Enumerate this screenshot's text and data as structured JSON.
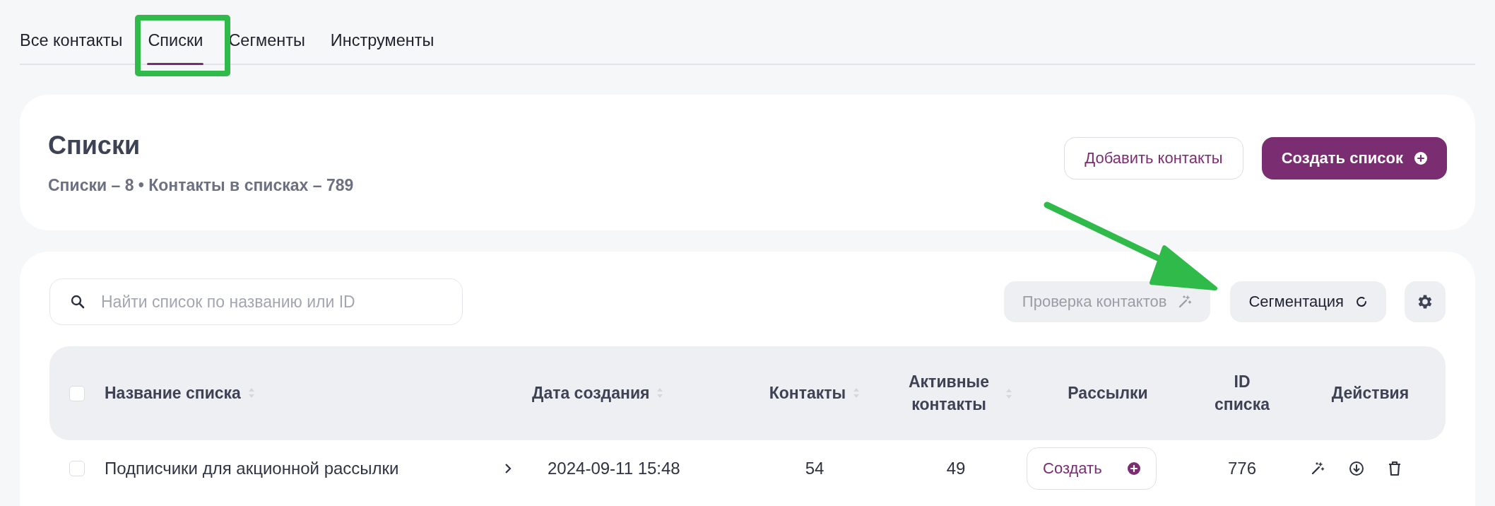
{
  "tabs": [
    {
      "label": "Все контакты",
      "selected": false
    },
    {
      "label": "Списки",
      "selected": true
    },
    {
      "label": "Сегменты",
      "selected": false
    },
    {
      "label": "Инструменты",
      "selected": false
    }
  ],
  "header": {
    "title": "Списки",
    "subtitle": "Списки – 8 • Контакты в списках – 789",
    "buttons": [
      {
        "label": "Добавить контакты",
        "kind": "outline"
      },
      {
        "label": "Создать список",
        "kind": "primary"
      }
    ]
  },
  "toolbar": {
    "search": {
      "placeholder": "Найти список по названию или ID"
    },
    "buttons": [
      {
        "label": "Проверка контактов",
        "kind": "wand",
        "disabled": true
      },
      {
        "label": "Сегментация",
        "kind": "refresh",
        "disabled": false
      }
    ]
  },
  "table": {
    "header_checked": false,
    "columns": [
      {
        "label": "Название списка",
        "sortable": true
      },
      {
        "label": "Дата создания",
        "sortable": true
      },
      {
        "label": "Контакты",
        "sortable": true
      },
      {
        "label": "Активные контакты",
        "sortable": true
      },
      {
        "label": "Рассылки",
        "sortable": false
      },
      {
        "label": "ID списка",
        "sortable": false
      },
      {
        "label": "Действия",
        "sortable": false
      }
    ],
    "rows": [
      {
        "checked": false,
        "name": "Подписчики для акционной рассылки",
        "date": "2024-09-11 15:48",
        "contacts": "54",
        "active": "49",
        "mailing_button": "Создать",
        "id": "776"
      }
    ]
  }
}
